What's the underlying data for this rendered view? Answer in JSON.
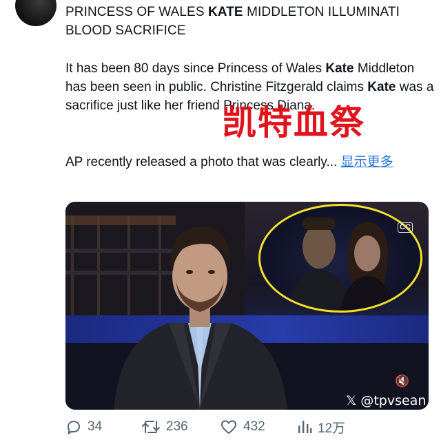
{
  "post": {
    "headline_pre": "PRINCESS OF WALES ",
    "headline_bold": "KATE",
    "headline_post": " MIDDLETON ILLUMINATI BLOOD SACRIFICE",
    "p1_a": "It has been 80 days since Princess of Wales ",
    "p1_b_bold": "Kate",
    "p1_c": " Middleton has been seen in public. Christine Fitzgerald claims ",
    "p1_d_bold": "Kate",
    "p1_e": " was a sacrifice just like her friend Princess Diana.",
    "p2_text": "AP recently released a photo that was clearly... ",
    "more_label": "显示更多"
  },
  "overlay": {
    "chinese_caption": "凯特血祭"
  },
  "media": {
    "cc_label": "CC",
    "mute_icon": "🔇",
    "watermark": "𝕏 @tpvsean"
  },
  "actions": {
    "replies": "34",
    "reposts": "236",
    "likes": "432",
    "views": "12万"
  },
  "colors": {
    "link": "#1d6fd8",
    "caption_red": "#e0141c",
    "highlight_circle": "#f5e12b",
    "action_gray": "#536471"
  }
}
